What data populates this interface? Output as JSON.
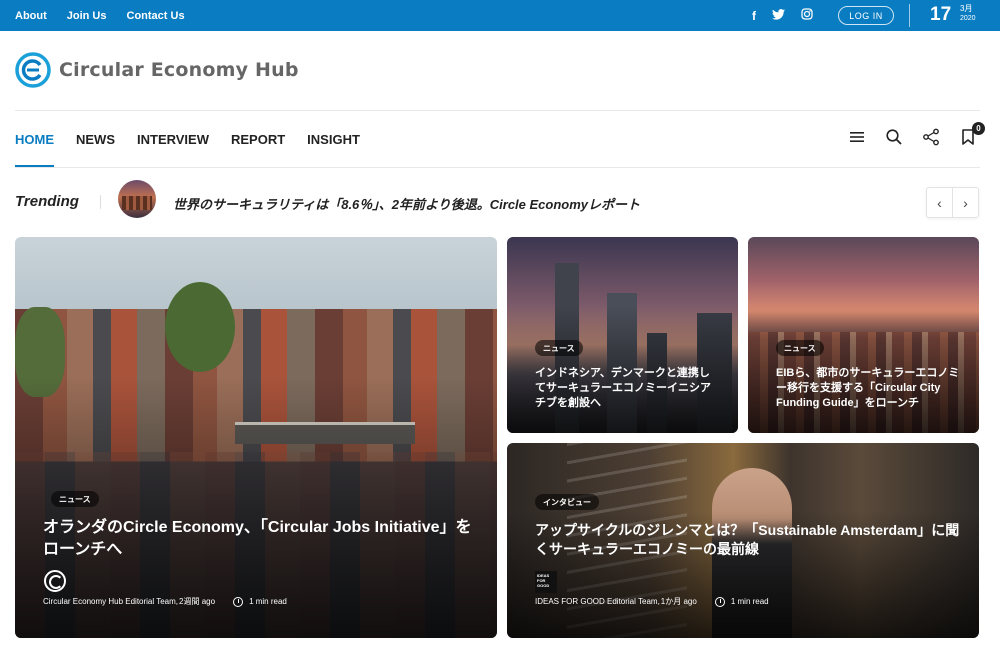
{
  "topbar": {
    "links": [
      "About",
      "Join Us",
      "Contact Us"
    ],
    "social": {
      "facebook": "f",
      "twitter": "🐦",
      "instagram": "◎"
    },
    "login_label": "LOG IN",
    "date": {
      "day": "17",
      "month": "3月",
      "year": "2020"
    },
    "background_color": "#0a7cc1"
  },
  "site": {
    "name": "Circular Economy Hub"
  },
  "nav": {
    "items": [
      "HOME",
      "NEWS",
      "INTERVIEW",
      "REPORT",
      "INSIGHT"
    ],
    "active": "HOME",
    "bookmark_count": "0",
    "icons": [
      "menu-icon",
      "search-icon",
      "share-icon",
      "bookmark-icon"
    ]
  },
  "trending": {
    "label": "Trending",
    "headline": "世界のサーキュラリティは「8.6％」、2年前より後退。Circle Economyレポート",
    "prev": "‹",
    "next": "›"
  },
  "cards": [
    {
      "tag": "ニュース",
      "title": "オランダのCircle Economy、「Circular Jobs Initiative」をローンチへ",
      "author": "Circular Economy Hub Editorial Team",
      "time_ago": "2週間 ago",
      "read_time": "1 min read"
    },
    {
      "tag": "ニュース",
      "title": "インドネシア、デンマークと連携してサーキュラーエコノミーイニシアチブを創設へ"
    },
    {
      "tag": "ニュース",
      "title": "EIBら、都市のサーキュラーエコノミー移行を支援する「Circular City Funding Guide」をローンチ"
    },
    {
      "tag": "インタビュー",
      "title": "アップサイクルのジレンマとは？「Sustainable Amsterdam」に聞くサーキュラーエコノミーの最前線",
      "author": "IDEAS FOR GOOD Editorial Team",
      "time_ago": "1か月 ago",
      "read_time": "1 min read",
      "avatar_text": "IDEAS FOR GOOD"
    }
  ]
}
